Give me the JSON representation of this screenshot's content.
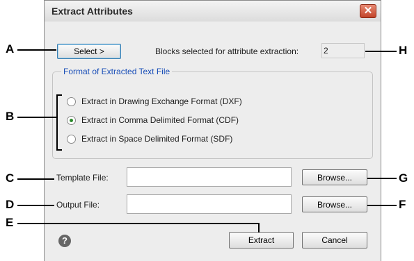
{
  "dialog": {
    "title": "Extract Attributes",
    "select_button": "Select >",
    "blocks_label": "Blocks selected for attribute extraction:",
    "blocks_value": "2",
    "format_group_label": "Format of Extracted Text File",
    "format_options": [
      {
        "label": "Extract in Drawing Exchange Format (DXF)",
        "selected": false
      },
      {
        "label": "Extract in Comma Delimited Format (CDF)",
        "selected": true
      },
      {
        "label": "Extract in Space Delimited Format (SDF)",
        "selected": false
      }
    ],
    "template_label": "Template File:",
    "template_value": "",
    "output_label": "Output File:",
    "output_value": "",
    "browse_label": "Browse...",
    "extract_button": "Extract",
    "cancel_button": "Cancel"
  },
  "callouts": [
    "A",
    "B",
    "C",
    "D",
    "E",
    "F",
    "G",
    "H"
  ],
  "icons": {
    "close": "close-icon",
    "help": "help-icon"
  }
}
